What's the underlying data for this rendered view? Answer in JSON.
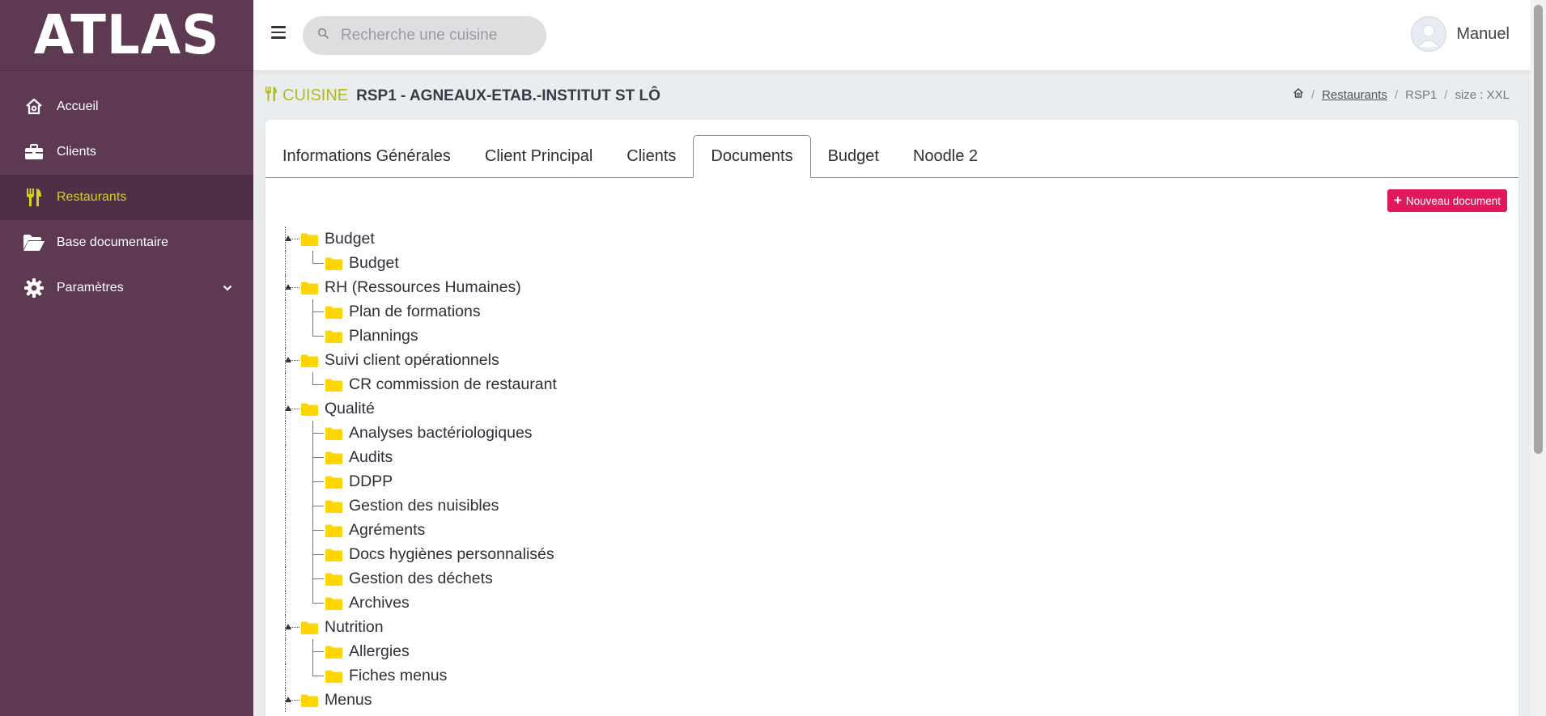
{
  "brand": {
    "logo_text": "ATLAS"
  },
  "sidebar": {
    "items": [
      {
        "label": "Accueil",
        "icon": "home-icon",
        "active": false
      },
      {
        "label": "Clients",
        "icon": "briefcase-icon",
        "active": false
      },
      {
        "label": "Restaurants",
        "icon": "utensils-icon",
        "active": true
      },
      {
        "label": "Base documentaire",
        "icon": "folder-open-icon",
        "active": false
      },
      {
        "label": "Paramètres",
        "icon": "gear-icon",
        "active": false,
        "has_submenu": true
      }
    ]
  },
  "topbar": {
    "search_placeholder": "Recherche une cuisine",
    "user_name": "Manuel"
  },
  "heading": {
    "section": "CUISINE",
    "title": "RSP1 - AGNEAUX-ETAB.-INSTITUT ST LÔ"
  },
  "breadcrumb": {
    "items": [
      "Restaurants",
      "RSP1",
      "size : XXL"
    ]
  },
  "tabs": [
    {
      "label": "Informations Générales",
      "active": false
    },
    {
      "label": "Client Principal",
      "active": false
    },
    {
      "label": "Clients",
      "active": false
    },
    {
      "label": "Documents",
      "active": true
    },
    {
      "label": "Budget",
      "active": false
    },
    {
      "label": "Noodle 2",
      "active": false
    }
  ],
  "actions": {
    "new_document": "Nouveau document"
  },
  "tree": [
    {
      "label": "Budget",
      "children": [
        "Budget"
      ]
    },
    {
      "label": "RH (Ressources Humaines)",
      "children": [
        "Plan de formations",
        "Plannings"
      ]
    },
    {
      "label": "Suivi client opérationnels",
      "children": [
        "CR commission de restaurant"
      ]
    },
    {
      "label": "Qualité",
      "children": [
        "Analyses bactériologiques",
        "Audits",
        "DDPP",
        "Gestion des nuisibles",
        "Agréments",
        "Docs hygiènes personnalisés",
        "Gestion des déchets",
        "Archives"
      ]
    },
    {
      "label": "Nutrition",
      "children": [
        "Allergies",
        "Fiches menus"
      ]
    },
    {
      "label": "Menus",
      "children": []
    }
  ],
  "colors": {
    "sidebar_bg": "#5e3a52",
    "sidebar_active_bg": "#4f2f45",
    "accent_yellow": "#d4d21e",
    "cuisine_green": "#b6b81f",
    "button_pink": "#e0195a",
    "folder_yellow": "#ffd500"
  }
}
